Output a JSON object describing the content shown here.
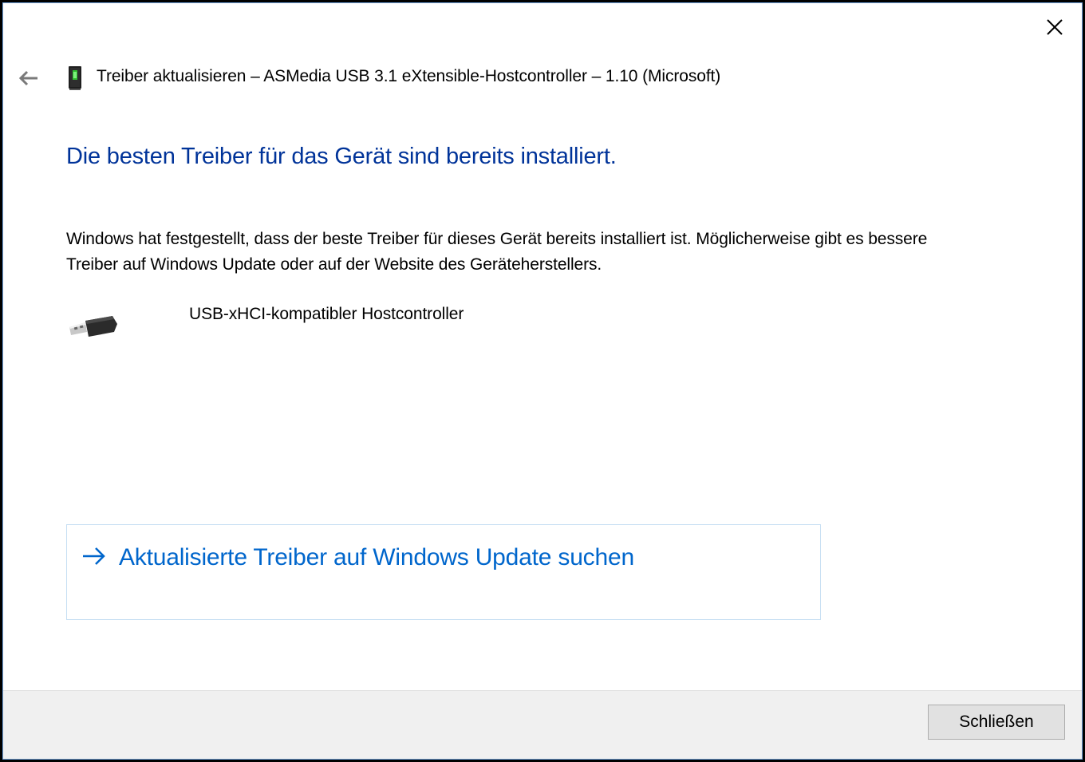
{
  "window": {
    "title": "Treiber aktualisieren – ASMedia USB 3.1 eXtensible-Hostcontroller – 1.10 (Microsoft)",
    "close_icon": "close-icon",
    "back_icon": "back-arrow-icon",
    "device_icon": "device-icon"
  },
  "main": {
    "heading": "Die besten Treiber für das Gerät sind bereits installiert.",
    "description": "Windows hat festgestellt, dass der beste Treiber für dieses Gerät bereits installiert ist. Möglicherweise gibt es bessere Treiber auf Windows Update oder auf der Website des Geräteherstellers.",
    "driver": {
      "icon": "usb-connector-icon",
      "name": "USB-xHCI-kompatibler Hostcontroller"
    },
    "link": {
      "icon": "right-arrow-icon",
      "label": "Aktualisierte Treiber auf Windows Update suchen"
    }
  },
  "footer": {
    "close_label": "Schließen"
  },
  "colors": {
    "heading": "#003399",
    "link": "#0066cc",
    "footer_bg": "#f0f0f0",
    "button_bg": "#e1e1e1"
  }
}
